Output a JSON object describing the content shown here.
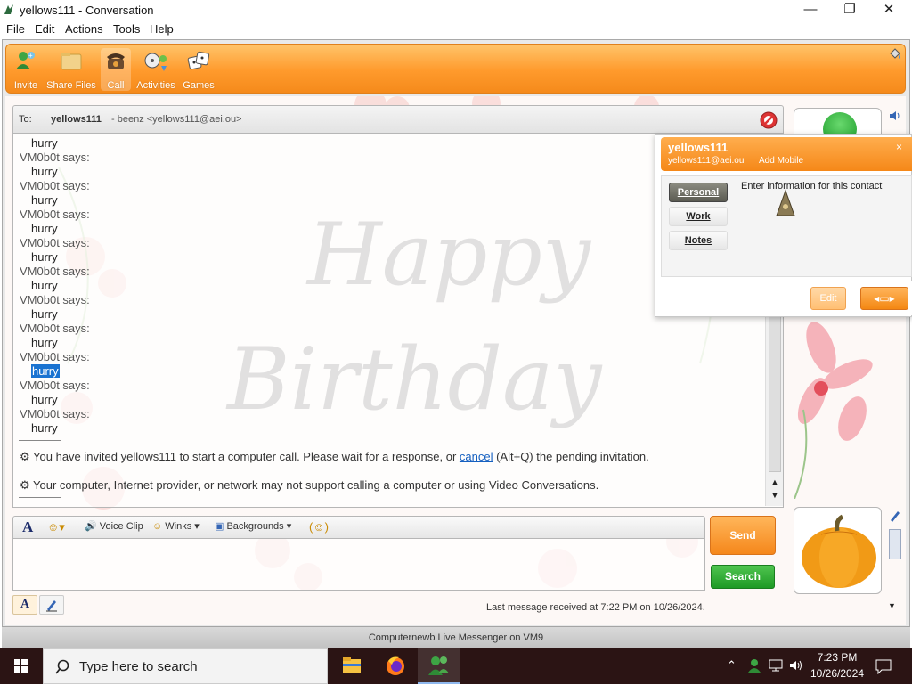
{
  "window": {
    "title": "yellows111 - Conversation",
    "controls": {
      "minimize": "—",
      "maximize": "❐",
      "close": "✕"
    }
  },
  "menu": [
    "File",
    "Edit",
    "Actions",
    "Tools",
    "Help"
  ],
  "toolbar": {
    "items": [
      {
        "label": "Invite",
        "icon": "invite-icon"
      },
      {
        "label": "Share Files",
        "icon": "folder-icon"
      },
      {
        "label": "Call",
        "icon": "phone-icon"
      },
      {
        "label": "Activities",
        "icon": "activities-icon"
      },
      {
        "label": "Games",
        "icon": "games-icon"
      }
    ]
  },
  "conversation": {
    "to_label": "To:",
    "to_name": "yellows111",
    "to_detail": "- beenz <yellows111@aei.ou>",
    "messages": [
      {
        "type": "text",
        "text": "hurry"
      },
      {
        "type": "sender",
        "text": "VM0b0t says:"
      },
      {
        "type": "text",
        "text": "hurry"
      },
      {
        "type": "sender",
        "text": "VM0b0t says:"
      },
      {
        "type": "text",
        "text": "hurry"
      },
      {
        "type": "sender",
        "text": "VM0b0t says:"
      },
      {
        "type": "text",
        "text": "hurry"
      },
      {
        "type": "sender",
        "text": "VM0b0t says:"
      },
      {
        "type": "text",
        "text": "hurry"
      },
      {
        "type": "sender",
        "text": "VM0b0t says:"
      },
      {
        "type": "text",
        "text": "hurry"
      },
      {
        "type": "sender",
        "text": "VM0b0t says:"
      },
      {
        "type": "text",
        "text": "hurry"
      },
      {
        "type": "sender",
        "text": "VM0b0t says:"
      },
      {
        "type": "text",
        "text": "hurry"
      },
      {
        "type": "sender",
        "text": "VM0b0t says:"
      },
      {
        "type": "text",
        "text": "hurry",
        "selected": true
      },
      {
        "type": "sender",
        "text": "VM0b0t says:"
      },
      {
        "type": "text",
        "text": "hurry"
      },
      {
        "type": "sender",
        "text": "VM0b0t says:"
      },
      {
        "type": "text",
        "text": "hurry"
      }
    ],
    "notice1_prefix": "You have invited yellows111 to start a computer call. Please wait for a response, or ",
    "notice1_link": "cancel",
    "notice1_suffix": " (Alt+Q) the pending invitation.",
    "notice2": "Your computer, Internet provider, or network may not support calling a computer or using Video Conversations.",
    "watermark_line1": "Happy",
    "watermark_line2": "Birthday"
  },
  "compose": {
    "font_glyph": "A",
    "emoticon_glyph": "☺▾",
    "voice_clip": "Voice Clip",
    "winks": "Winks ▾",
    "backgrounds": "Backgrounds ▾",
    "nudge_glyph": "(☺)",
    "send": "Send",
    "search": "Search",
    "last_message": "Last message received at 7:22 PM on 10/26/2024."
  },
  "contact_card": {
    "name": "yellows111",
    "email": "yellows111@aei.ou",
    "add_mobile": "Add Mobile",
    "close": "×",
    "tabs": [
      "Personal",
      "Work",
      "Notes"
    ],
    "active_tab": "Personal",
    "hint": "Enter information for this contact",
    "edit": "Edit",
    "expand": "◂▭▸"
  },
  "status_bar": "Computernewb Live Messenger on VM9",
  "taskbar": {
    "search_placeholder": "Type here to search",
    "time": "7:23 PM",
    "date": "10/26/2024"
  },
  "colors": {
    "accent_orange": "#f58818",
    "search_green": "#1e9a25",
    "selection_blue": "#1a73d1",
    "taskbar": "#2b1414"
  }
}
